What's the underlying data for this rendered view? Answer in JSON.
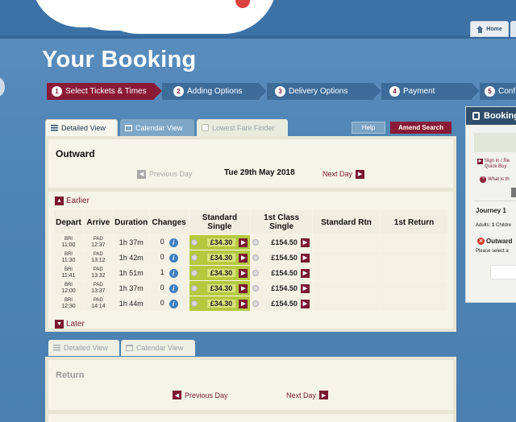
{
  "page_title": "Your Booking",
  "top_nav": {
    "home_label": "Home"
  },
  "steps": [
    {
      "num": "1",
      "label": "Select Tickets & Times"
    },
    {
      "num": "2",
      "label": "Adding Options"
    },
    {
      "num": "3",
      "label": "Delivery Options"
    },
    {
      "num": "4",
      "label": "Payment"
    },
    {
      "num": "5",
      "label": "Conf"
    }
  ],
  "view_tabs": {
    "detailed": "Detailed View",
    "calendar": "Calendar View",
    "lowest": "Lowest Fare Finder"
  },
  "buttons": {
    "help": "Help",
    "amend": "Amend Search"
  },
  "outward": {
    "title": "Outward",
    "prev_day": "Previous Day",
    "date": "Tue 29th May 2018",
    "next_day": "Next Day",
    "earlier": "Earlier",
    "later": "Later",
    "headers": [
      "Depart",
      "Arrive",
      "Duration",
      "Changes",
      "Standard Single",
      "1st Class Single",
      "Standard Rtn",
      "1st Return"
    ],
    "rows": [
      {
        "dep_st": "BRI",
        "dep": "11:00",
        "arr_st": "PAD",
        "arr": "12:37",
        "dur": "1h 37m",
        "chg": "0",
        "std": "£34.30",
        "first": "£154.50"
      },
      {
        "dep_st": "BRI",
        "dep": "11:30",
        "arr_st": "PAD",
        "arr": "13:12",
        "dur": "1h 42m",
        "chg": "0",
        "std": "£34.30",
        "first": "£154.50"
      },
      {
        "dep_st": "BRI",
        "dep": "11:41",
        "arr_st": "PAD",
        "arr": "13:32",
        "dur": "1h 51m",
        "chg": "1",
        "std": "£34.30",
        "first": "£154.50"
      },
      {
        "dep_st": "BRI",
        "dep": "12:00",
        "arr_st": "PAD",
        "arr": "13:37",
        "dur": "1h 37m",
        "chg": "0",
        "std": "£34.30",
        "first": "£154.50"
      },
      {
        "dep_st": "BRI",
        "dep": "12:30",
        "arr_st": "PAD",
        "arr": "14:14",
        "dur": "1h 44m",
        "chg": "0",
        "std": "£34.30",
        "first": "£154.50"
      }
    ]
  },
  "return_tabs": {
    "detailed": "Detailed View",
    "calendar": "Calendar View"
  },
  "return": {
    "title": "Return",
    "prev_day": "Previous Day",
    "next_day": "Next Day"
  },
  "side_panel": {
    "title": "Booking",
    "signin_line1": "Sign in / Re",
    "signin_line2": "Quick Buy",
    "what_is": "What is th",
    "journey": "Journey 1",
    "adults_label": "Adults:",
    "adults_value": "1",
    "adults_rest": "Childre",
    "outward": "Outward",
    "please": "Please select a"
  },
  "colors": {
    "brand_maroon": "#8a1a36",
    "selected_fare": "#b4c93f",
    "info_blue": "#3f7fc0",
    "background_blue": "#4f84b6"
  }
}
